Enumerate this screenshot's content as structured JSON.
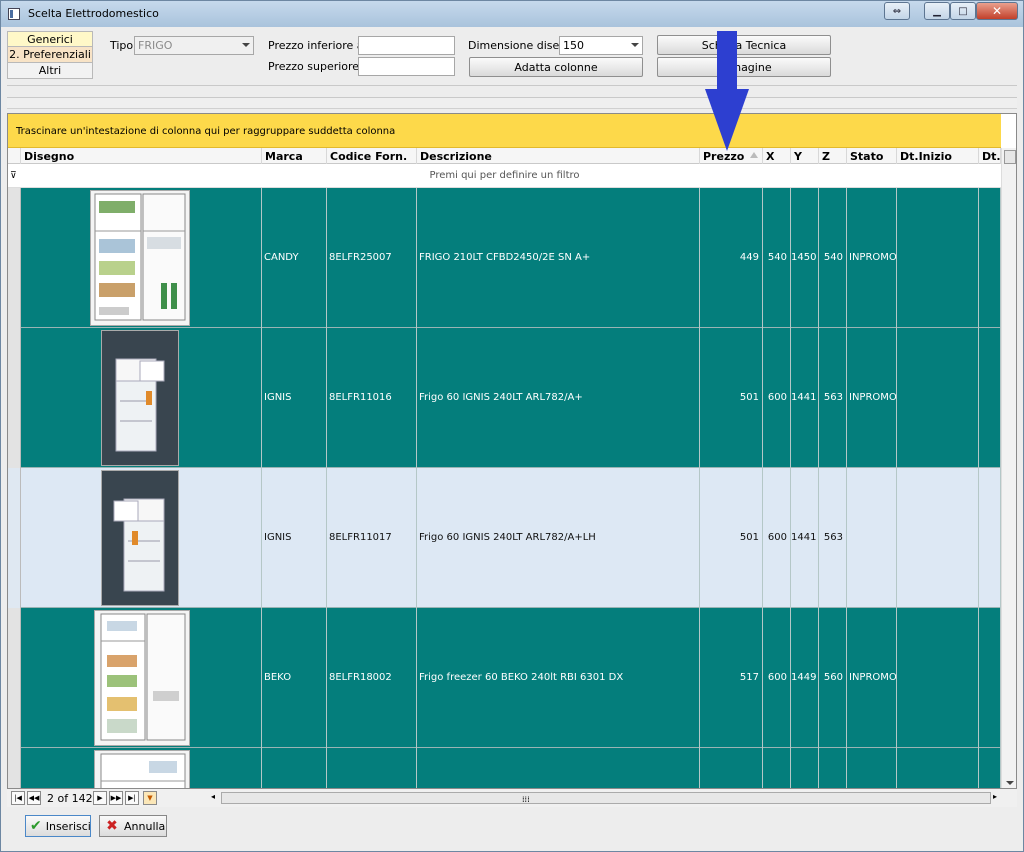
{
  "window": {
    "title": "Scelta Elettrodomestico"
  },
  "tabs": [
    {
      "label": "Generici"
    },
    {
      "label": "2. Preferenziali"
    },
    {
      "label": "Altri"
    }
  ],
  "filters": {
    "tipo_label": "Tipo",
    "tipo_value": "FRIGO",
    "prezzo_inf_label": "Prezzo inferiore a",
    "prezzo_sup_label": "Prezzo superiore a",
    "dimensione_label": "Dimensione disegni",
    "dimensione_value": "150",
    "adatta_button": "Adatta colonne",
    "scheda_button": "Scheda Tecnica",
    "immagine_button": "Immagine"
  },
  "grid": {
    "group_hint": "Trascinare un'intestazione di colonna qui per raggruppare suddetta colonna",
    "filter_hint": "Premi qui per definire un filtro",
    "columns": [
      "Disegno",
      "Marca",
      "Codice Forn.",
      "Descrizione",
      "Prezzo",
      "X",
      "Y",
      "Z",
      "Stato",
      "Dt.Inizio Stato",
      "Dt.F"
    ],
    "rows": [
      {
        "marca": "CANDY",
        "codice": "8ELFR25007",
        "descrizione": "FRIGO 210LT CFBD2450/2E SN  A+",
        "prezzo": "449",
        "x": "540",
        "y": "1450",
        "z": "540",
        "stato": "INPROMO"
      },
      {
        "marca": "IGNIS",
        "codice": "8ELFR11016",
        "descrizione": "Frigo 60 IGNIS 240LT ARL782/A+",
        "prezzo": "501",
        "x": "600",
        "y": "1441",
        "z": "563",
        "stato": "INPROMO"
      },
      {
        "marca": "IGNIS",
        "codice": "8ELFR11017",
        "descrizione": "Frigo 60 IGNIS 240LT ARL782/A+LH",
        "prezzo": "501",
        "x": "600",
        "y": "1441",
        "z": "563",
        "stato": ""
      },
      {
        "marca": "BEKO",
        "codice": "8ELFR18002",
        "descrizione": "Frigo freezer 60 BEKO 240lt RBI 6301 DX",
        "prezzo": "517",
        "x": "600",
        "y": "1449",
        "z": "560",
        "stato": "INPROMO"
      },
      {
        "marca": "",
        "codice": "",
        "descrizione": "",
        "prezzo": "",
        "x": "",
        "y": "",
        "z": "",
        "stato": ""
      }
    ]
  },
  "pager": {
    "text": "2 of 142"
  },
  "footer": {
    "inserisci": "Inserisci",
    "annulla": "Annulla"
  },
  "colors": {
    "teal_row": "#047e7c",
    "selected_row": "#dde8f4",
    "group_bar": "#fdd94a",
    "annotation_arrow": "#2d3fd0"
  }
}
